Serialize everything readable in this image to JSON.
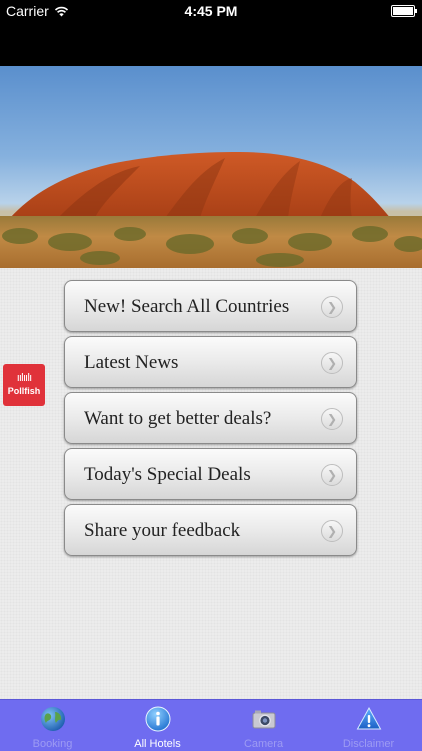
{
  "status_bar": {
    "carrier": "Carrier",
    "time": "4:45 PM"
  },
  "hero": {
    "image_icon": "uluru-photo"
  },
  "menu": {
    "items": [
      {
        "label": "New! Search All Countries"
      },
      {
        "label": "Latest News"
      },
      {
        "label": "Want to get better deals?"
      },
      {
        "label": "Today's Special Deals"
      },
      {
        "label": "Share your feedback"
      }
    ],
    "chevron_glyph": "❯"
  },
  "pollfish": {
    "label": "Pollfish",
    "wave": "ıılıılı"
  },
  "tab_bar": {
    "tabs": [
      {
        "label": "Booking",
        "icon": "globe-icon",
        "active": false
      },
      {
        "label": "All Hotels",
        "icon": "info-icon",
        "active": true
      },
      {
        "label": "Camera",
        "icon": "camera-icon",
        "active": false
      },
      {
        "label": "Disclaimer",
        "icon": "warning-icon",
        "active": false
      }
    ]
  },
  "colors": {
    "tab_bar_bg": "#6f6cf0",
    "pollfish_red": "#e0323a",
    "rock": "#c5501f"
  }
}
